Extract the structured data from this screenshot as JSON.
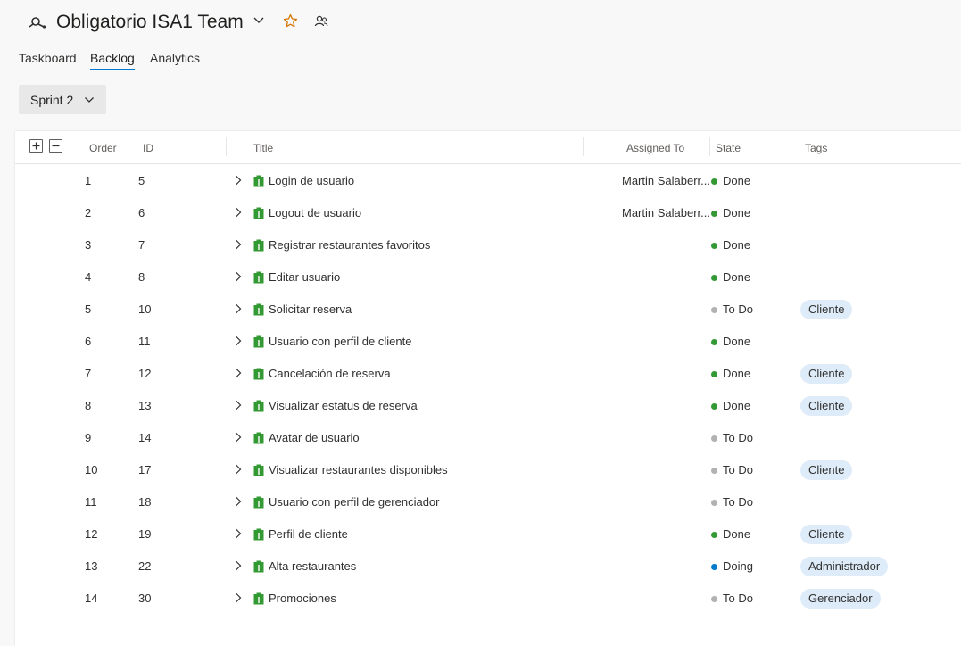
{
  "header": {
    "title": "Obligatorio ISA1 Team",
    "team_icon": "team-icon",
    "favorite_icon": "star-icon",
    "members_icon": "people-icon",
    "colors": {
      "star": "#d47500",
      "accent": "#0078d4"
    }
  },
  "tabs": [
    {
      "label": "Taskboard",
      "active": false
    },
    {
      "label": "Backlog",
      "active": true
    },
    {
      "label": "Analytics",
      "active": false
    }
  ],
  "sprint_selector": {
    "label": "Sprint 2"
  },
  "grid": {
    "columns": {
      "order": "Order",
      "id": "ID",
      "title": "Title",
      "assigned_to": "Assigned To",
      "state": "State",
      "tags": "Tags"
    },
    "state_colors": {
      "Done": "#339933",
      "To Do": "#b2b2b2",
      "Doing": "#007acc"
    },
    "rows": [
      {
        "order": "1",
        "id": "5",
        "title": "Login de usuario",
        "assigned": "Martin Salaberr...",
        "state": "Done",
        "tag": ""
      },
      {
        "order": "2",
        "id": "6",
        "title": "Logout de usuario",
        "assigned": "Martin Salaberr...",
        "state": "Done",
        "tag": ""
      },
      {
        "order": "3",
        "id": "7",
        "title": "Registrar restaurantes favoritos",
        "assigned": "",
        "state": "Done",
        "tag": ""
      },
      {
        "order": "4",
        "id": "8",
        "title": "Editar usuario",
        "assigned": "",
        "state": "Done",
        "tag": ""
      },
      {
        "order": "5",
        "id": "10",
        "title": "Solicitar reserva",
        "assigned": "",
        "state": "To Do",
        "tag": "Cliente"
      },
      {
        "order": "6",
        "id": "11",
        "title": "Usuario con perfil de cliente",
        "assigned": "",
        "state": "Done",
        "tag": ""
      },
      {
        "order": "7",
        "id": "12",
        "title": "Cancelación de reserva",
        "assigned": "",
        "state": "Done",
        "tag": "Cliente"
      },
      {
        "order": "8",
        "id": "13",
        "title": "Visualizar estatus de reserva",
        "assigned": "",
        "state": "Done",
        "tag": "Cliente"
      },
      {
        "order": "9",
        "id": "14",
        "title": "Avatar de usuario",
        "assigned": "",
        "state": "To Do",
        "tag": ""
      },
      {
        "order": "10",
        "id": "17",
        "title": "Visualizar restaurantes disponibles",
        "assigned": "",
        "state": "To Do",
        "tag": "Cliente"
      },
      {
        "order": "11",
        "id": "18",
        "title": "Usuario con perfil de gerenciador",
        "assigned": "",
        "state": "To Do",
        "tag": ""
      },
      {
        "order": "12",
        "id": "19",
        "title": "Perfil de cliente",
        "assigned": "",
        "state": "Done",
        "tag": "Cliente"
      },
      {
        "order": "13",
        "id": "22",
        "title": "Alta restaurantes",
        "assigned": "",
        "state": "Doing",
        "tag": "Administrador"
      },
      {
        "order": "14",
        "id": "30",
        "title": "Promociones",
        "assigned": "",
        "state": "To Do",
        "tag": "Gerenciador"
      }
    ]
  }
}
